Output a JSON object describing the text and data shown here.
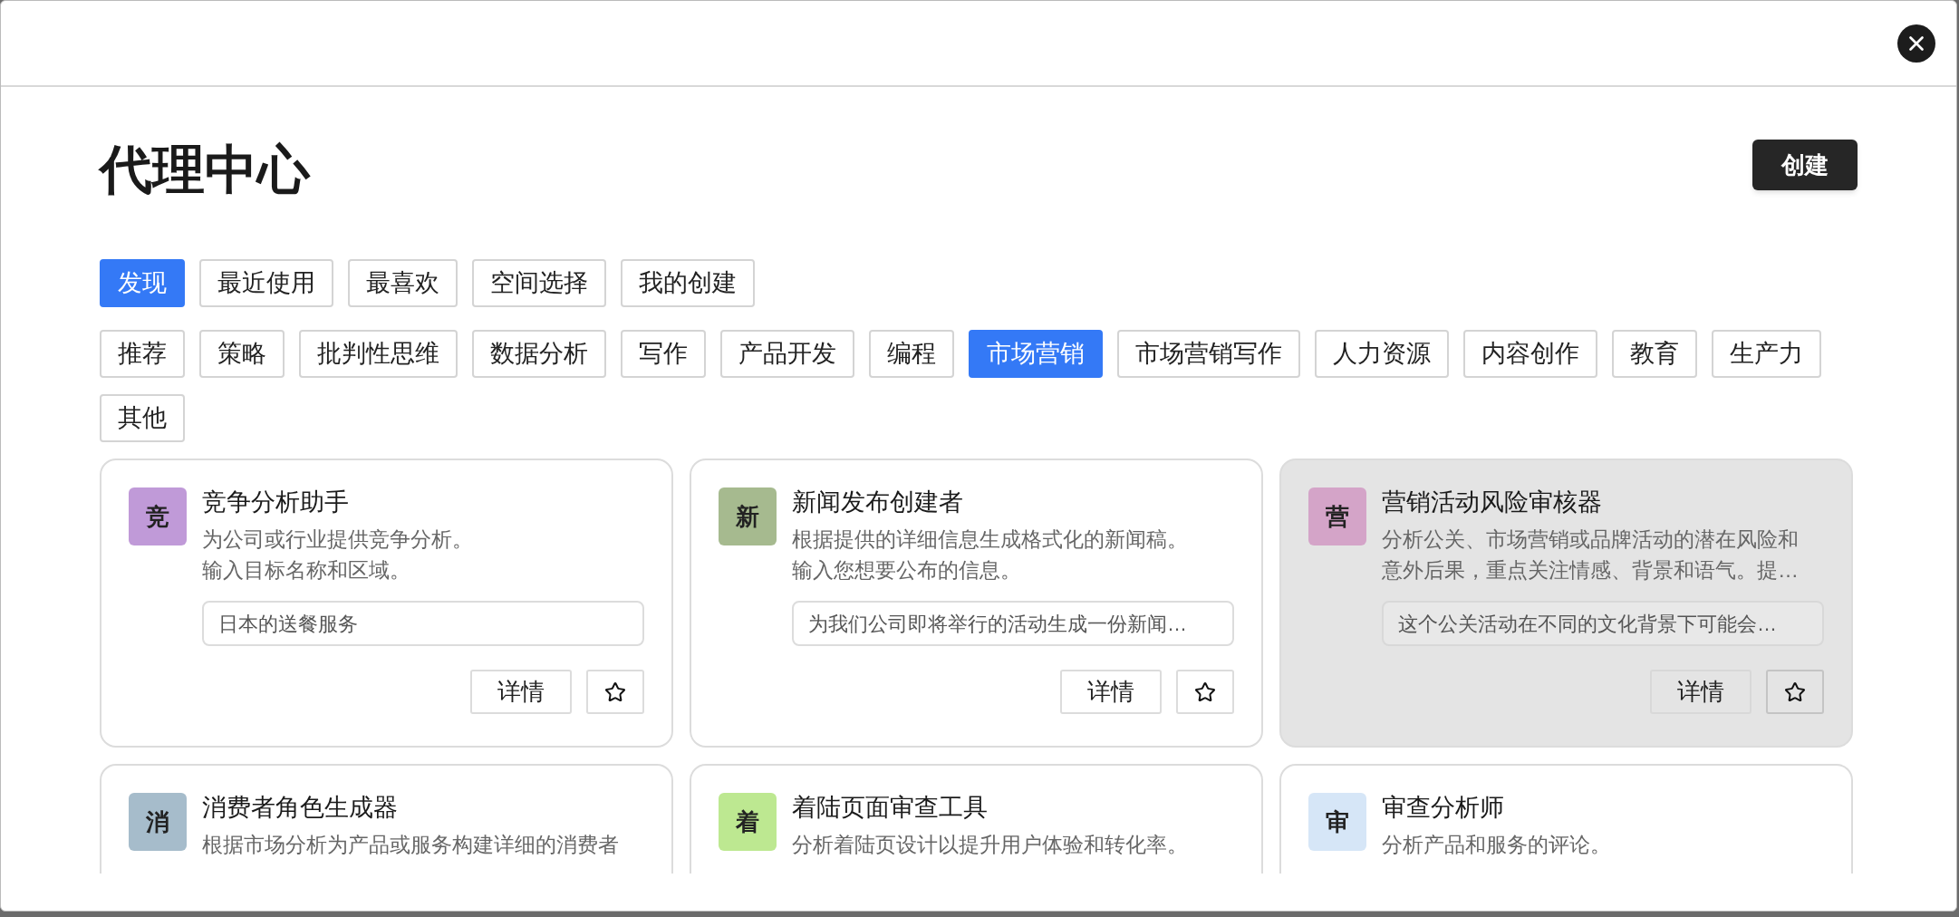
{
  "title": "代理中心",
  "create_button": "创建",
  "tabs": [
    {
      "label": "发现",
      "selected": true
    },
    {
      "label": "最近使用",
      "selected": false
    },
    {
      "label": "最喜欢",
      "selected": false
    },
    {
      "label": "空间选择",
      "selected": false
    },
    {
      "label": "我的创建",
      "selected": false
    }
  ],
  "categories": [
    {
      "label": "推荐",
      "selected": false
    },
    {
      "label": "策略",
      "selected": false
    },
    {
      "label": "批判性思维",
      "selected": false
    },
    {
      "label": "数据分析",
      "selected": false
    },
    {
      "label": "写作",
      "selected": false
    },
    {
      "label": "产品开发",
      "selected": false
    },
    {
      "label": "编程",
      "selected": false
    },
    {
      "label": "市场营销",
      "selected": true
    },
    {
      "label": "市场营销写作",
      "selected": false
    },
    {
      "label": "人力资源",
      "selected": false
    },
    {
      "label": "内容创作",
      "selected": false
    },
    {
      "label": "教育",
      "selected": false
    },
    {
      "label": "生产力",
      "selected": false
    },
    {
      "label": "其他",
      "selected": false
    }
  ],
  "cards": [
    {
      "badge": "竞",
      "color": "#c09ad8",
      "name": "竞争分析助手",
      "description": [
        "为公司或行业提供竞争分析。",
        "输入目标名称和区域。"
      ],
      "input": "日本的送餐服务",
      "details": "详情",
      "hovered": false
    },
    {
      "badge": "新",
      "color": "#a6ba8f",
      "name": "新闻发布创建者",
      "description": [
        "根据提供的详细信息生成格式化的新闻稿。",
        "输入您想要公布的信息。"
      ],
      "input": "为我们公司即将举行的活动生成一份新闻…",
      "details": "详情",
      "hovered": false
    },
    {
      "badge": "营",
      "color": "#d4a4c8",
      "name": "营销活动风险审核器",
      "description": [
        "分析公关、市场营销或品牌活动的潜在风险和意外后果，重点关注情感、背景和语气。提…"
      ],
      "input": "这个公关活动在不同的文化背景下可能会…",
      "details": "详情",
      "hovered": true
    },
    {
      "badge": "消",
      "color": "#a6bccb",
      "name": "消费者角色生成器",
      "description": [
        "根据市场分析为产品或服务构建详细的消费者"
      ],
      "hovered": false
    },
    {
      "badge": "着",
      "color": "#bde891",
      "name": "着陆页面审查工具",
      "description": [
        "分析着陆页设计以提升用户体验和转化率。"
      ],
      "hovered": false
    },
    {
      "badge": "审",
      "color": "#d6e6f7",
      "name": "审查分析师",
      "description": [
        "分析产品和服务的评论。"
      ],
      "hovered": false
    }
  ]
}
